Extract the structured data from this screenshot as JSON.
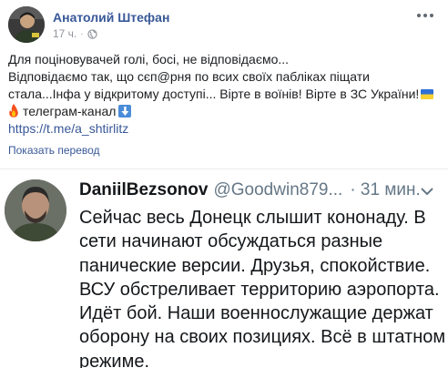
{
  "post": {
    "author": "Анатолий Штефан",
    "time": "17 ч.",
    "privacy_icon": "globe-icon",
    "lines": [
      "Для поціновувачей голі, босі, не відповідаємо...",
      "Відповідаємо так, що сєп@рня по всих своїх пабліках піщати",
      "стала...Інфа у відкритому доступі... Вірте в воїнів! Вірте в ЗС України!"
    ],
    "telegram_label": "телеграм-канал",
    "link": "https://t.me/a_shtirlitz",
    "translate": "Показать перевод"
  },
  "tweet": {
    "name": "DaniilBezsonov",
    "handle": "@Goodwin879...",
    "time": "· 31 мин.",
    "lines": [
      "Сейчас весь Донецк слышит кононаду. В",
      "сети начинают обсуждаться разные",
      "панические версии. Друзья, спокойствие.",
      "ВСУ обстреливает территорию аэропорта.",
      "Идёт бой. Наши военнослужащие держат",
      "оборону на своих позициях. Всё в штатном",
      "режиме."
    ]
  },
  "colors": {
    "fb_link": "#385898",
    "meta_gray": "#90949c",
    "tweet_gray": "#657786",
    "text": "#1c1e21"
  }
}
